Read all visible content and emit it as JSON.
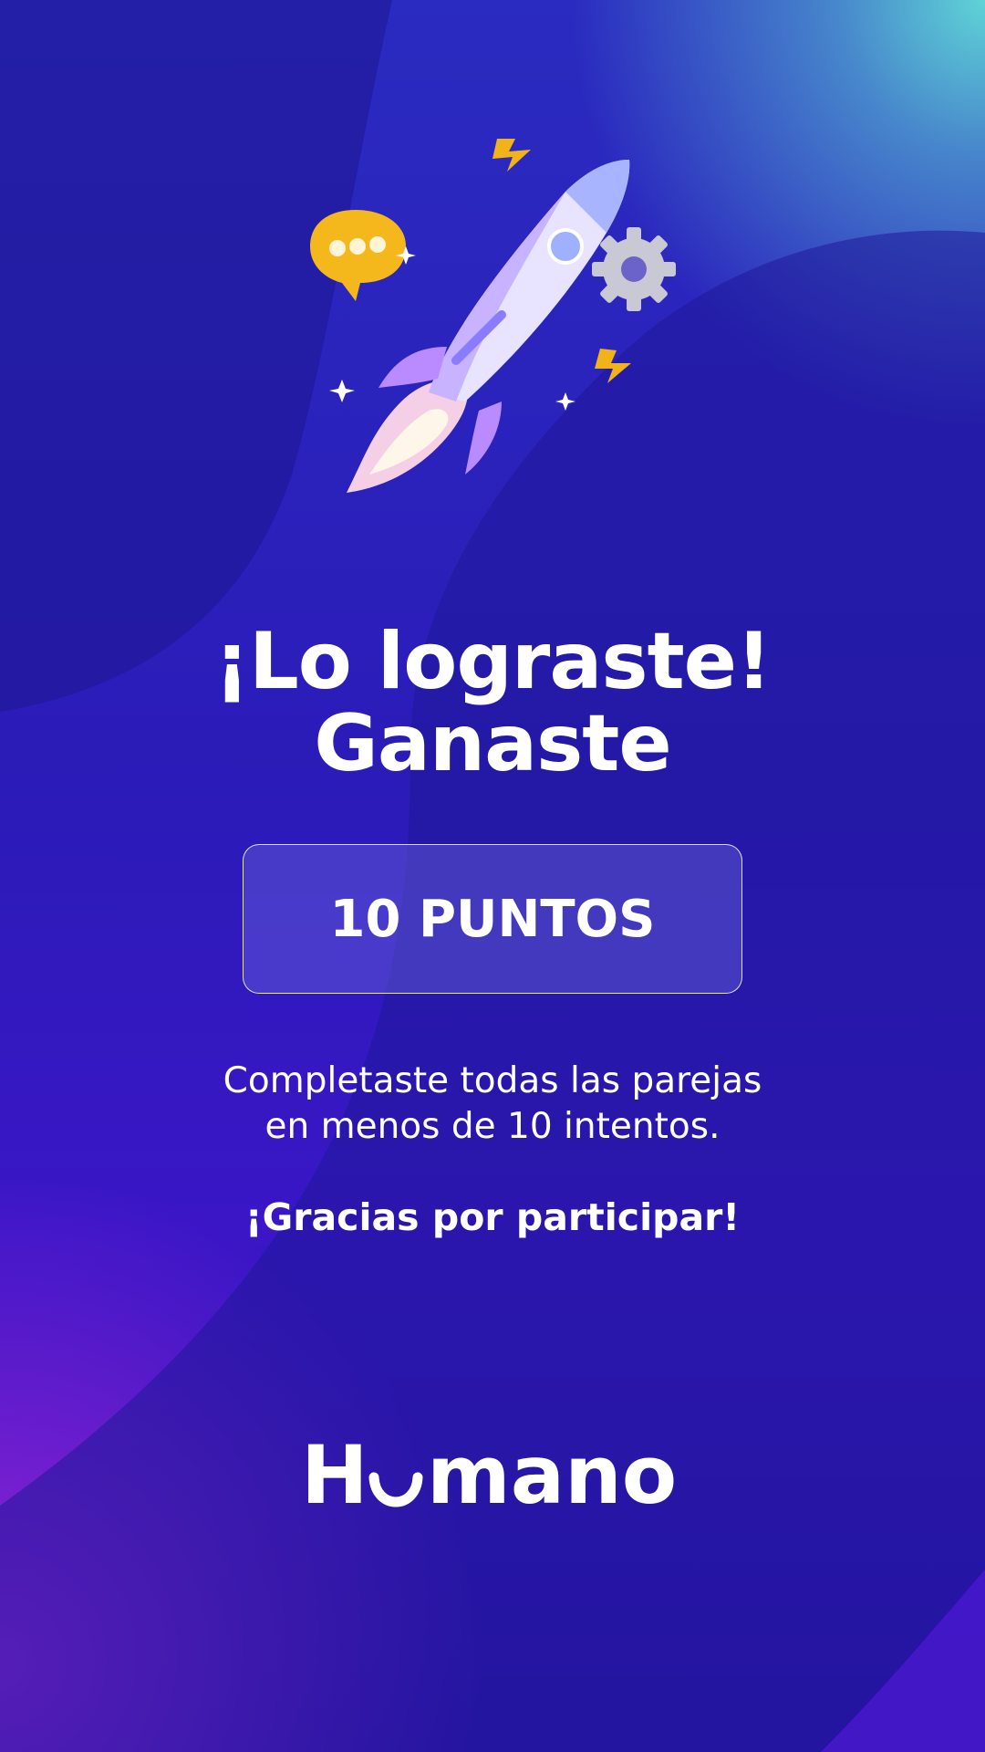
{
  "screen": {
    "headline": {
      "line1": "¡Lo lograste!",
      "line2": "Ganaste"
    },
    "points_label": "10 PUNTOS",
    "description": {
      "line1": "Completaste todas las parejas",
      "line2": "en menos de 10 intentos."
    },
    "thanks": "¡Gracias por participar!",
    "brand": {
      "name": "Humano"
    }
  },
  "colors": {
    "background": "#2a1bb8",
    "accent_teal": "#5fd3d6",
    "accent_purple": "#9b2be0",
    "text": "#ffffff",
    "bubble_yellow": "#f5b81c"
  },
  "icons": [
    "rocket-icon",
    "chat-bubble-icon",
    "gear-icon",
    "lightning-icon",
    "star-icon"
  ]
}
